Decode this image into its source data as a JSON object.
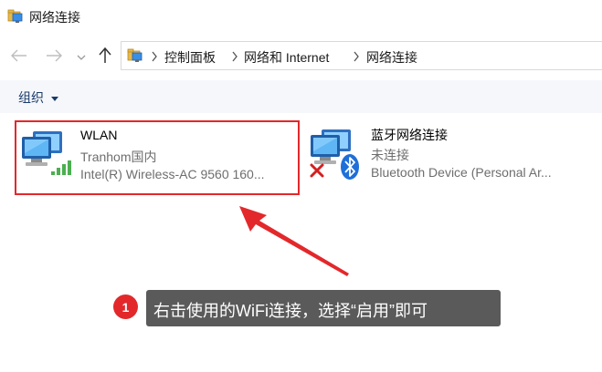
{
  "window": {
    "title": "网络连接",
    "icon": "network-connections-icon"
  },
  "navigation": {
    "breadcrumbs": [
      "控制面板",
      "网络和 Internet",
      "网络连接"
    ]
  },
  "toolbar": {
    "organize_label": "组织"
  },
  "connections": [
    {
      "name": "WLAN",
      "network": "Tranhom国内",
      "device": "Intel(R) Wireless-AC 9560 160...",
      "icon": "wifi-adapter-icon",
      "highlighted": true
    },
    {
      "name": "蓝牙网络连接",
      "network": "未连接",
      "device": "Bluetooth Device (Personal Ar...",
      "icon": "bluetooth-adapter-icon",
      "status_icon": "disconnected-x-icon"
    }
  ],
  "annotation": {
    "step": "1",
    "text": "右击使用的WiFi连接，选择“启用”即可",
    "color": "#e3282b"
  }
}
